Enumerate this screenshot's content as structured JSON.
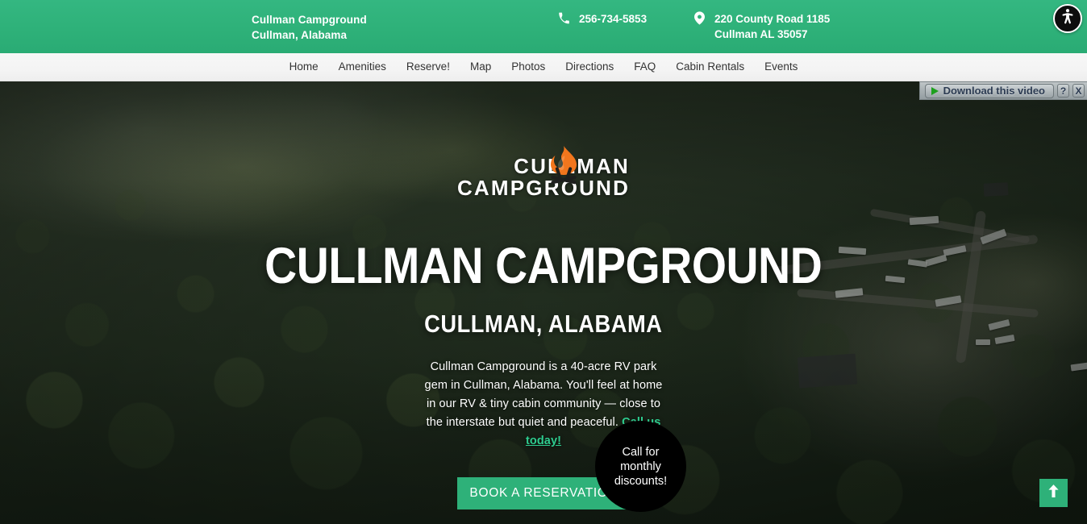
{
  "topbar": {
    "business_name": "Cullman Campground",
    "business_location": "Cullman, Alabama",
    "phone": "256-734-5853",
    "address_line1": "220 County Road 1185",
    "address_line2": "Cullman AL 35057",
    "phone_icon": "phone-icon",
    "location_icon": "map-pin-icon",
    "accent_color": "#2eb179"
  },
  "accessibility": {
    "label": "Accessibility Menu",
    "icon": "accessibility-icon"
  },
  "nav": {
    "items": [
      {
        "label": "Home"
      },
      {
        "label": "Amenities"
      },
      {
        "label": "Reserve!"
      },
      {
        "label": "Map"
      },
      {
        "label": "Photos"
      },
      {
        "label": "Directions"
      },
      {
        "label": "FAQ"
      },
      {
        "label": "Cabin Rentals"
      },
      {
        "label": "Events"
      }
    ]
  },
  "hero": {
    "logo": {
      "line1": "CULLMAN",
      "line2": "CAMPGROUND",
      "icon": "campfire-icon",
      "flame_color": "#f2761d",
      "log_color": "#1d1f1e"
    },
    "title": "CULLMAN CAMPGROUND",
    "subtitle": "CULLMAN, ALABAMA",
    "description_part1": "Cullman Campground is a 40-acre RV park gem in Cullman, Alabama. You'll feel at home in our RV & tiny cabin community — close to the interstate but quiet and peaceful. ",
    "description_link": "Call us today!",
    "link_color": "#2ecc8f",
    "book_button": "BOOK A RESERVATION",
    "button_color": "#2eb179",
    "badge_line1": "Call for",
    "badge_line2": "monthly",
    "badge_line3": "discounts!",
    "badge_bg": "#000000",
    "background_description": "Aerial drone view of a forested RV campground at golden hour"
  },
  "download_bar": {
    "label": "Download this video",
    "help_label": "?",
    "close_label": "X",
    "play_icon": "play-icon"
  },
  "back_to_top": {
    "label": "Back to top",
    "icon": "arrow-up-icon",
    "color": "#2eb179"
  }
}
